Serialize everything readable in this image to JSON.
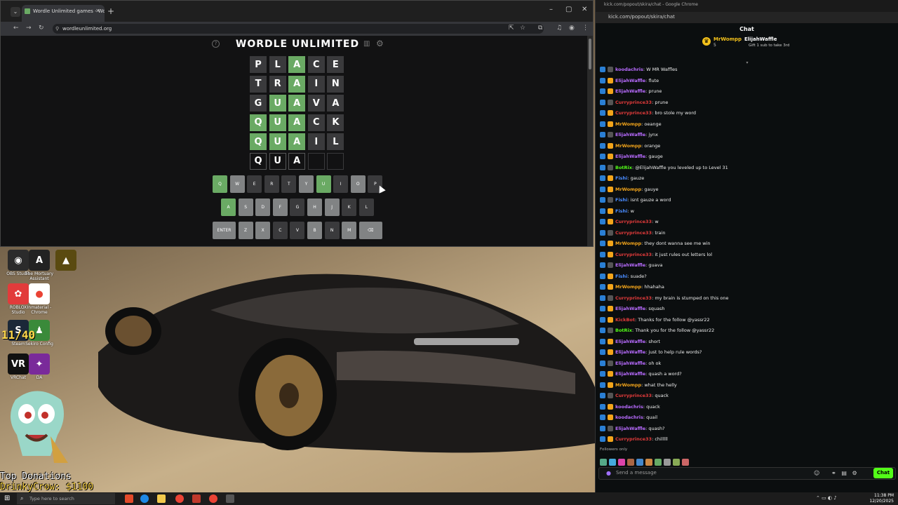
{
  "browser": {
    "tab_title": "Wordle Unlimited games - Wo",
    "url": "wordleunlimited.org",
    "new_tab": "+",
    "menu_glyph": "⌄"
  },
  "wordle": {
    "title": "WORDLE UNLIMITED",
    "board": [
      [
        {
          "l": "P",
          "s": "absent"
        },
        {
          "l": "L",
          "s": "absent"
        },
        {
          "l": "A",
          "s": "correct"
        },
        {
          "l": "C",
          "s": "absent"
        },
        {
          "l": "E",
          "s": "absent"
        }
      ],
      [
        {
          "l": "T",
          "s": "absent"
        },
        {
          "l": "R",
          "s": "absent"
        },
        {
          "l": "A",
          "s": "correct"
        },
        {
          "l": "I",
          "s": "absent"
        },
        {
          "l": "N",
          "s": "absent"
        }
      ],
      [
        {
          "l": "G",
          "s": "absent"
        },
        {
          "l": "U",
          "s": "correct"
        },
        {
          "l": "A",
          "s": "correct"
        },
        {
          "l": "V",
          "s": "absent"
        },
        {
          "l": "A",
          "s": "absent"
        }
      ],
      [
        {
          "l": "Q",
          "s": "correct"
        },
        {
          "l": "U",
          "s": "correct"
        },
        {
          "l": "A",
          "s": "correct"
        },
        {
          "l": "C",
          "s": "absent"
        },
        {
          "l": "K",
          "s": "absent"
        }
      ],
      [
        {
          "l": "Q",
          "s": "correct"
        },
        {
          "l": "U",
          "s": "correct"
        },
        {
          "l": "A",
          "s": "correct"
        },
        {
          "l": "I",
          "s": "absent"
        },
        {
          "l": "L",
          "s": "absent"
        }
      ],
      [
        {
          "l": "Q",
          "s": "typed"
        },
        {
          "l": "U",
          "s": "typed"
        },
        {
          "l": "A",
          "s": "typed"
        },
        {
          "l": "",
          "s": "empty"
        },
        {
          "l": "",
          "s": "empty"
        }
      ]
    ],
    "keyboard": [
      [
        {
          "k": "Q",
          "s": "correct"
        },
        {
          "k": "W",
          "s": "unused"
        },
        {
          "k": "E",
          "s": "absent"
        },
        {
          "k": "R",
          "s": "absent"
        },
        {
          "k": "T",
          "s": "absent"
        },
        {
          "k": "Y",
          "s": "unused"
        },
        {
          "k": "U",
          "s": "correct"
        },
        {
          "k": "I",
          "s": "absent"
        },
        {
          "k": "O",
          "s": "unused"
        },
        {
          "k": "P",
          "s": "absent"
        }
      ],
      [
        {
          "k": "A",
          "s": "correct"
        },
        {
          "k": "S",
          "s": "unused"
        },
        {
          "k": "D",
          "s": "unused"
        },
        {
          "k": "F",
          "s": "unused"
        },
        {
          "k": "G",
          "s": "absent"
        },
        {
          "k": "H",
          "s": "unused"
        },
        {
          "k": "J",
          "s": "unused"
        },
        {
          "k": "K",
          "s": "absent"
        },
        {
          "k": "L",
          "s": "absent"
        }
      ],
      [
        {
          "k": "ENTER",
          "s": "unused"
        },
        {
          "k": "Z",
          "s": "unused"
        },
        {
          "k": "X",
          "s": "unused"
        },
        {
          "k": "C",
          "s": "absent"
        },
        {
          "k": "V",
          "s": "absent"
        },
        {
          "k": "B",
          "s": "unused"
        },
        {
          "k": "N",
          "s": "absent"
        },
        {
          "k": "M",
          "s": "unused"
        },
        {
          "k": "⌫",
          "s": "unused"
        }
      ]
    ]
  },
  "desktop": {
    "icons": [
      {
        "label": "OBS Studio",
        "color": "#2b2b2b",
        "glyph": "◉"
      },
      {
        "label": "The Mortuary Assistant",
        "color": "#222",
        "glyph": "A"
      },
      {
        "label": "",
        "color": "#5a4a10",
        "glyph": "▲"
      },
      {
        "label": "ROBLOX Studio",
        "color": "#e23b3b",
        "glyph": "✿"
      },
      {
        "label": "Inmaterial - Chrome",
        "color": "#fff",
        "glyph": "●"
      },
      {
        "label": "Steam",
        "color": "#1b2838",
        "glyph": "S"
      },
      {
        "label": "Sekiro Config",
        "color": "#3a8a3a",
        "glyph": "♟"
      },
      {
        "label": "VRChat",
        "color": "#111",
        "glyph": "VR"
      },
      {
        "label": "DA",
        "color": "#7a2a9a",
        "glyph": "✦"
      }
    ],
    "counter": "11/40",
    "donations_title": "Top Donations",
    "donations_line": "DrinkyCrow: $1100"
  },
  "chat": {
    "window_title": "kick.com/popout/skira/chat - Google Chrome",
    "url": "kick.com/popout/skira/chat",
    "header": "Chat",
    "pinned_user": "MrWompp",
    "pinned_sub_count": "5",
    "pinned_user2": "ElijahWaffle",
    "pinned_user2_count": "5",
    "pinned_text": "Gift 1 sub to take 3rd",
    "messages": [
      {
        "user": "koodachris",
        "color": "#b86bff",
        "text": ": W MR Waffles"
      },
      {
        "user": "ElijahWaffle",
        "color": "#b86bff",
        "text": ": flute"
      },
      {
        "user": "ElijahWaffle",
        "color": "#b86bff",
        "text": ": prune"
      },
      {
        "user": "Curryprince33",
        "color": "#e23b3b",
        "text": ": prune"
      },
      {
        "user": "Curryprince33",
        "color": "#e23b3b",
        "text": ": bro stole my word"
      },
      {
        "user": "MrWompp",
        "color": "#f3a51b",
        "text": ": oeange"
      },
      {
        "user": "ElijahWaffle",
        "color": "#b86bff",
        "text": ": jynx"
      },
      {
        "user": "MrWompp",
        "color": "#f3a51b",
        "text": ": orange"
      },
      {
        "user": "ElijahWaffle",
        "color": "#b86bff",
        "text": ": gauge"
      },
      {
        "user": "BotRix",
        "color": "#53fc18",
        "text": ": @ElijahWaffle you leveled up to Level 31"
      },
      {
        "user": "Fishi",
        "color": "#4a8cff",
        "text": ": gauze"
      },
      {
        "user": "MrWompp",
        "color": "#f3a51b",
        "text": ": gauye"
      },
      {
        "user": "Fishi",
        "color": "#4a8cff",
        "text": ": isnt gauze a word"
      },
      {
        "user": "Fishi",
        "color": "#4a8cff",
        "text": ": w"
      },
      {
        "user": "Curryprince33",
        "color": "#e23b3b",
        "text": ": w"
      },
      {
        "user": "Curryprince33",
        "color": "#e23b3b",
        "text": ": train"
      },
      {
        "user": "MrWompp",
        "color": "#f3a51b",
        "text": ": they dont wanna see me win"
      },
      {
        "user": "Curryprince33",
        "color": "#e23b3b",
        "text": ": it just rules out letters lol"
      },
      {
        "user": "ElijahWaffle",
        "color": "#b86bff",
        "text": ": guava"
      },
      {
        "user": "Fishi",
        "color": "#4a8cff",
        "text": ": suade?"
      },
      {
        "user": "MrWompp",
        "color": "#f3a51b",
        "text": ": hhahaha"
      },
      {
        "user": "Curryprince33",
        "color": "#e23b3b",
        "text": ": my brain is stumped on this one"
      },
      {
        "user": "ElijahWaffle",
        "color": "#b86bff",
        "text": ": squash"
      },
      {
        "user": "KickBot",
        "color": "#e23b3b",
        "text": ": Thanks for the follow @yassr22"
      },
      {
        "user": "BotRix",
        "color": "#53fc18",
        "text": ": Thank you for the follow @yassr22"
      },
      {
        "user": "ElijahWaffle",
        "color": "#b86bff",
        "text": ": short"
      },
      {
        "user": "ElijahWaffle",
        "color": "#b86bff",
        "text": ": just to help rule words?"
      },
      {
        "user": "ElijahWaffle",
        "color": "#b86bff",
        "text": ": oh ok"
      },
      {
        "user": "ElijahWaffle",
        "color": "#b86bff",
        "text": ": quash a word?"
      },
      {
        "user": "MrWompp",
        "color": "#f3a51b",
        "text": ": what the helly"
      },
      {
        "user": "Curryprince33",
        "color": "#e23b3b",
        "text": ": quack"
      },
      {
        "user": "koodachris",
        "color": "#b86bff",
        "text": ": quack"
      },
      {
        "user": "koodachris",
        "color": "#b86bff",
        "text": ": quail"
      },
      {
        "user": "ElijahWaffle",
        "color": "#b86bff",
        "text": ": quash?"
      },
      {
        "user": "Curryprince33",
        "color": "#e23b3b",
        "text": ": chilllll"
      }
    ],
    "followers_only": "Followers only",
    "input_placeholder": "Send a message",
    "send_label": "Chat"
  },
  "taskbar": {
    "search_placeholder": "Type here to search",
    "time": "11:38 PM",
    "date": "12/20/2025"
  }
}
